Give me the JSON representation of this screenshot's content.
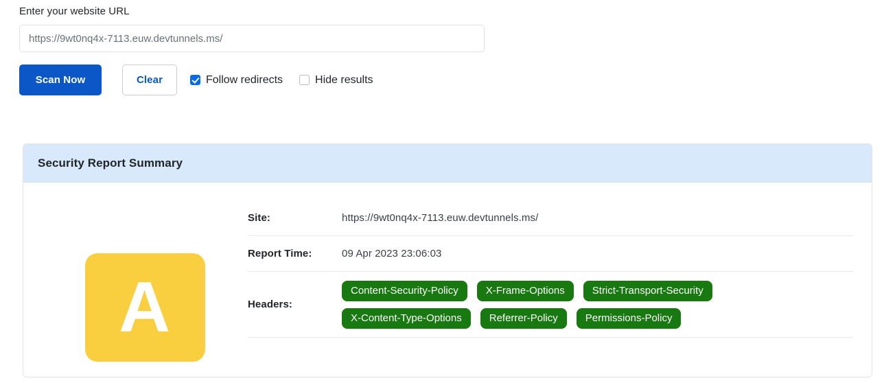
{
  "form": {
    "url_label": "Enter your website URL",
    "url_value": "https://9wt0nq4x-7113.euw.devtunnels.ms/",
    "url_placeholder": "https://9wt0nq4x-7113.euw.devtunnels.ms/",
    "scan_button": "Scan Now",
    "clear_button": "Clear",
    "checkboxes": [
      {
        "label": "Follow redirects",
        "checked": true
      },
      {
        "label": "Hide results",
        "checked": false
      }
    ]
  },
  "report": {
    "title": "Security Report Summary",
    "grade": "A",
    "grade_color": "#f9cf40",
    "rows": [
      {
        "label": "Site:",
        "value": "https://9wt0nq4x-7113.euw.devtunnels.ms/"
      },
      {
        "label": "Report Time:",
        "value": "09 Apr 2023 23:06:03"
      }
    ],
    "headers_label": "Headers:",
    "headers_badge_color": "#17790f",
    "headers": [
      "Content-Security-Policy",
      "X-Frame-Options",
      "Strict-Transport-Security",
      "X-Content-Type-Options",
      "Referrer-Policy",
      "Permissions-Policy"
    ]
  },
  "theme": {
    "primary": "#0b57c7",
    "header_bg": "#d7e9fb"
  }
}
